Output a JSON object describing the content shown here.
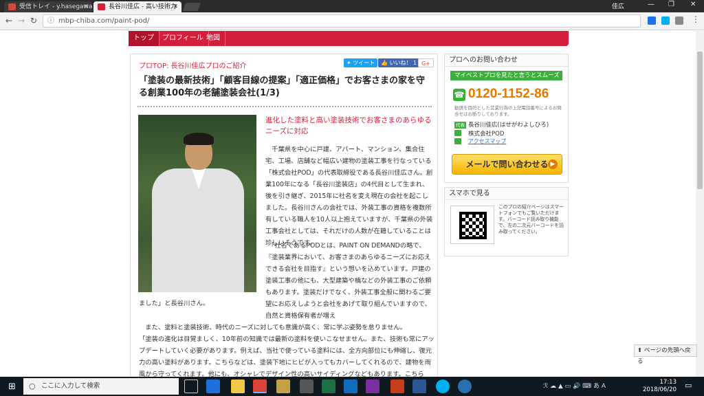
{
  "browser": {
    "tabs": [
      {
        "title": "受信トレイ - y.hasegawa@",
        "active": false,
        "favicon_color": "#d44638"
      },
      {
        "title": "長谷川佳広 - 高い技術力",
        "active": true,
        "favicon_color": "#d41f3c"
      }
    ],
    "user": "佳広",
    "url": "mbp-chiba.com/paint-pod/"
  },
  "site_nav": {
    "items": [
      "トップ",
      "プロフィール",
      "地図"
    ],
    "active": 0
  },
  "main": {
    "breadcrumb": "プロTOP: 長谷川佳広プロのご紹介",
    "tweet_label": "ツイート",
    "like_label": "いいね！ 1",
    "gplus_label": "G+",
    "headline": "「塗装の最新技術」「顧客目線の提案」「適正価格」でお客さまの家を守る創業100年の老舗塗装会社(1/3)",
    "subheading": "進化した塗料と高い塗装技術でお客さまのあらゆるニーズに対応",
    "p1": "千葉県を中心に戸建、アパート、マンション、集合住宅、工場、店舗など幅広い建物の塗装工事を行なっている「株式会社POD」の代表取締役である長谷川佳広さん。創業100年になる「長谷川塗装店」の4代目として生まれ、後を引き継ぎ、2015年に社名を変え現在の会社を起こしました。長谷川さんの会社では、外装工事の資格を複数所有している職人を10人以上抱えていますが、千葉県の外装工事会社としては、それだけの人数が在籍していることは珍しいそうです。",
    "p2": "「社名であるPODとは、PAINT ON DEMANDの略で、『塗装業界において、お客さまのあらゆるニーズにお応えできる会社を目指す』という想いを込めています。戸建の塗装工事の他にも、大型建築や橋などの外装工事のご依頼もあります。塗装だけでなく、外装工事全般に関わるご要望にお応えしようと会社をあげて取り組んでいますので、自然と資格保有者が増え",
    "p2_end": "ました」と長谷川さん。",
    "p3": "また、塗料と塗装技術、時代のニーズに対しても意識が高く、常に学ぶ姿勢を怠りません。",
    "p4": "「塗装の進化は目覚ましく、10年前の知識では最新の塗料を使いこなせません。また、技術も常にアップデートしていく必要があります。例えば、当社で使っている塗料には、全方向部位にも伸縮し、復元力の高い塗料があります。こちらなどは、塗装下地にヒビが入ってもカバーしてくれるので、建物を雨風から守ってくれます。他にも、オシャレでデザイン性の高いサイディングなどもあります。こちらは、外壁を個性豊かにしたいと望まれ"
  },
  "contact": {
    "title": "プロへのお問い合わせ",
    "banner": "マイベストプロを見たと言うとスムーズです",
    "phone": "0120-1152-86",
    "note": "勧誘を目的とした営業行為の上記電話番号によるお問合せはお断りしております。",
    "tag": "代表",
    "name": "長谷川佳広(はせがわよしひろ)",
    "company": "株式会社POD",
    "map_link": "アクセスマップ",
    "mail_button": "メールで問い合わせる"
  },
  "smartphone": {
    "title": "スマホで見る",
    "text": "このプロの紹介ページはスマートフォンでもご覧いただけます。バーコード読み取り機能で、左の二次元バーコードを読み取ってください。"
  },
  "page_top": "ページの先頭へ戻る",
  "taskbar": {
    "search_placeholder": "ここに入力して検索",
    "time": "17:13",
    "date": "2018/06/20"
  }
}
